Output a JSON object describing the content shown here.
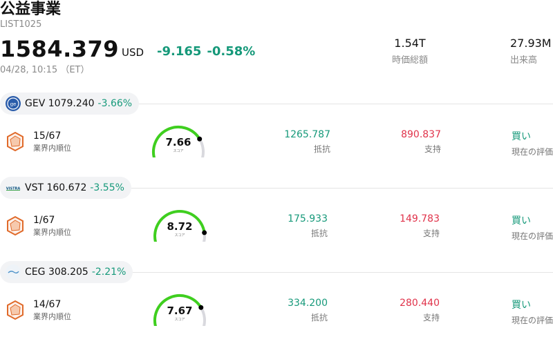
{
  "header": {
    "title": "公益事業",
    "code": "LIST1025",
    "price": "1584.379",
    "currency": "USD",
    "change": "-9.165",
    "change_pct": "-0.58%",
    "time": "04/28, 10:15 （ET）",
    "stats": [
      {
        "value": "1.54T",
        "label": "時価総額"
      },
      {
        "value": "27.93M",
        "label": "出来高"
      }
    ]
  },
  "stocks": [
    {
      "ticker": "GEV",
      "price": "1079.240",
      "change_pct": "-3.66%",
      "logo_icon": "ge-logo-icon",
      "logo_color": "#2a5caa",
      "rank": "15/67",
      "rank_label": "業界内順位",
      "score": "7.66",
      "score_label": "スコア",
      "score_fraction": 0.766,
      "resistance": "1265.787",
      "resistance_label": "抵抗",
      "support": "890.837",
      "support_label": "支持",
      "rating": "買い",
      "rating_label": "現在の評価"
    },
    {
      "ticker": "VST",
      "price": "160.672",
      "change_pct": "-3.55%",
      "logo_icon": "vistra-logo-icon",
      "logo_color": "#0b4f7c",
      "rank": "1/67",
      "rank_label": "業界内順位",
      "score": "8.72",
      "score_label": "スコア",
      "score_fraction": 0.872,
      "resistance": "175.933",
      "resistance_label": "抵抗",
      "support": "149.783",
      "support_label": "支持",
      "rating": "買い",
      "rating_label": "現在の評価"
    },
    {
      "ticker": "CEG",
      "price": "308.205",
      "change_pct": "-2.21%",
      "logo_icon": "constellation-logo-icon",
      "logo_color": "#4a90c8",
      "rank": "14/67",
      "rank_label": "業界内順位",
      "score": "7.67",
      "score_label": "スコア",
      "score_fraction": 0.767,
      "resistance": "334.200",
      "resistance_label": "抵抗",
      "support": "280.440",
      "support_label": "支持",
      "rating": "買い",
      "rating_label": "現在の評価"
    }
  ],
  "colors": {
    "up": "#16997a",
    "down": "#e0324a",
    "gauge": "#3fcf1f",
    "gauge_track": "#d9d9de",
    "hex": "#e06a2a"
  }
}
